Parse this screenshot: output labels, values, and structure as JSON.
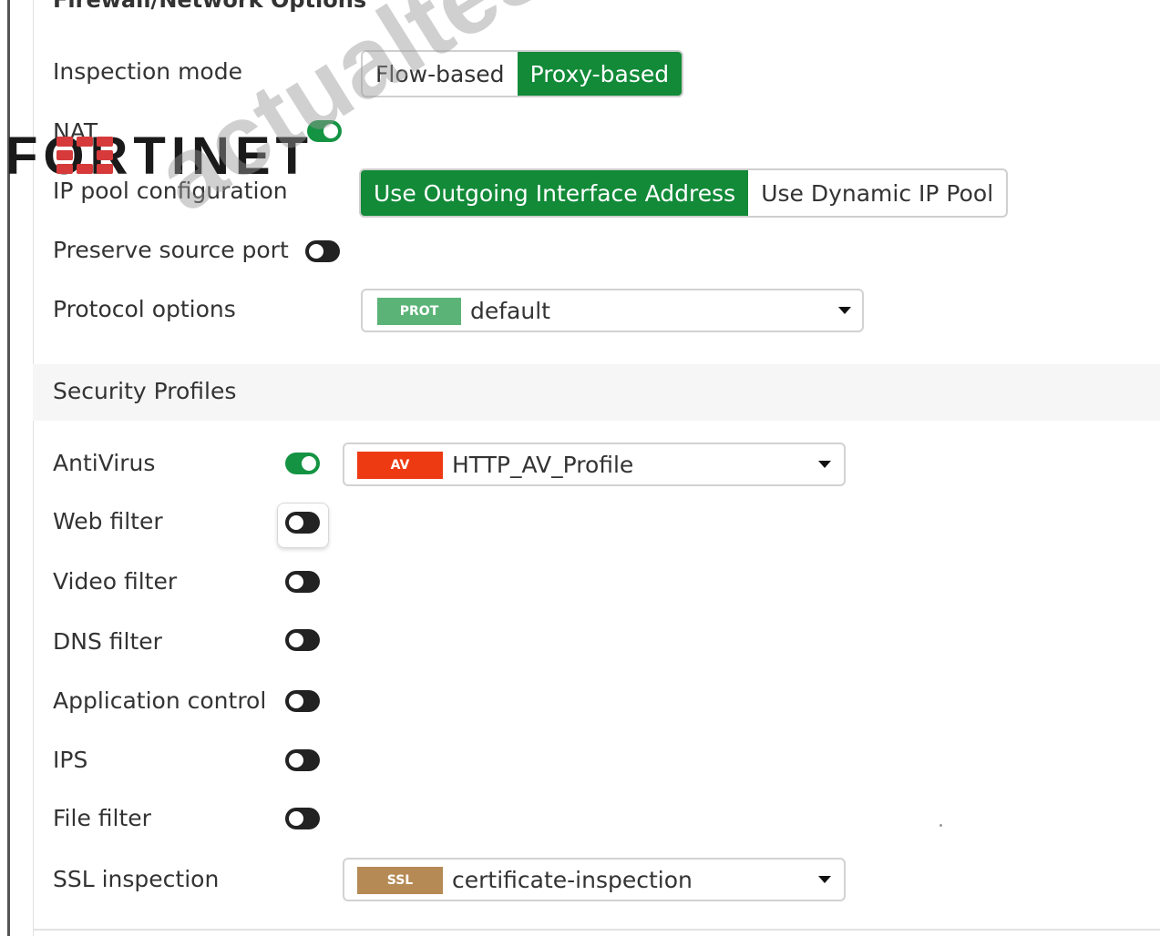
{
  "section_header_top": "Firewall/Network Options",
  "inspection_mode": {
    "label": "Inspection mode",
    "options": [
      "Flow-based",
      "Proxy-based"
    ],
    "selected": "Proxy-based"
  },
  "nat": {
    "label": "NAT",
    "enabled": true
  },
  "ip_pool": {
    "label": "IP pool configuration",
    "options": [
      "Use Outgoing Interface Address",
      "Use Dynamic IP Pool"
    ],
    "selected": "Use Outgoing Interface Address"
  },
  "preserve_source_port": {
    "label": "Preserve source port",
    "enabled": false
  },
  "protocol_options": {
    "label": "Protocol options",
    "badge": "PROT",
    "value": "default",
    "badge_color": "#5cb377"
  },
  "security_profiles": {
    "title": "Security Profiles",
    "antivirus": {
      "label": "AntiVirus",
      "enabled": true,
      "badge": "AV",
      "value": "HTTP_AV_Profile",
      "badge_color": "#ee3a12"
    },
    "web_filter": {
      "label": "Web filter",
      "enabled": false
    },
    "video_filter": {
      "label": "Video filter",
      "enabled": false
    },
    "dns_filter": {
      "label": "DNS filter",
      "enabled": false
    },
    "application_control": {
      "label": "Application control",
      "enabled": false
    },
    "ips": {
      "label": "IPS",
      "enabled": false
    },
    "file_filter": {
      "label": "File filter",
      "enabled": false
    },
    "ssl_inspection": {
      "label": "SSL inspection",
      "badge": "SSL",
      "value": "certificate-inspection",
      "badge_color": "#b58a55"
    }
  },
  "overlay": {
    "logo": "FORTINET",
    "watermark": "actualtest"
  },
  "colors": {
    "accent_green": "#128a38",
    "toggle_on": "#149443",
    "toggle_off": "#222222"
  },
  "icons": {
    "dropdown": "caret-down-icon"
  }
}
